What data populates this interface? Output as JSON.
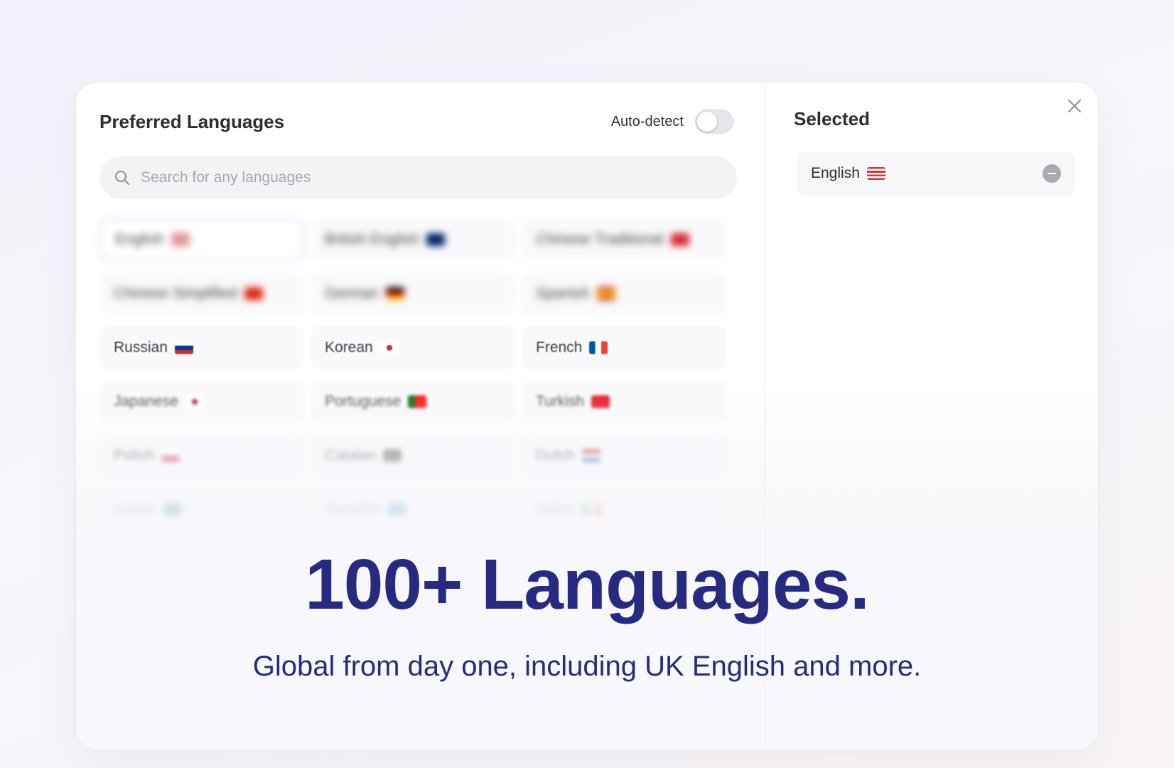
{
  "panel": {
    "title": "Preferred Languages",
    "auto_detect_label": "Auto-detect",
    "auto_detect_on": false
  },
  "search": {
    "placeholder": "Search for any languages",
    "value": ""
  },
  "languages": [
    {
      "label": "English",
      "flag": "flag-us-icon",
      "selected": true
    },
    {
      "label": "British English",
      "flag": "flag-gb-icon",
      "selected": false
    },
    {
      "label": "Chinese Traditional",
      "flag": "flag-tw-icon",
      "selected": false
    },
    {
      "label": "Chinese Simplified",
      "flag": "flag-cn-icon",
      "selected": false
    },
    {
      "label": "German",
      "flag": "flag-de-icon",
      "selected": false
    },
    {
      "label": "Spanish",
      "flag": "flag-es-icon",
      "selected": false
    },
    {
      "label": "Russian",
      "flag": "flag-ru-icon",
      "selected": false
    },
    {
      "label": "Korean",
      "flag": "flag-kr-icon",
      "selected": false
    },
    {
      "label": "French",
      "flag": "flag-fr-icon",
      "selected": false
    },
    {
      "label": "Japanese",
      "flag": "flag-jp-icon",
      "selected": false
    },
    {
      "label": "Portuguese",
      "flag": "flag-pt-icon",
      "selected": false
    },
    {
      "label": "Turkish",
      "flag": "flag-tr-icon",
      "selected": false
    },
    {
      "label": "Polish",
      "flag": "flag-pl-icon",
      "selected": false
    },
    {
      "label": "Catalan",
      "flag": "flag-ct-icon",
      "selected": false
    },
    {
      "label": "Dutch",
      "flag": "flag-nl-icon",
      "selected": false
    },
    {
      "label": "Arabic",
      "flag": "flag-sa-icon",
      "selected": false
    },
    {
      "label": "Swedish",
      "flag": "flag-se-icon",
      "selected": false
    },
    {
      "label": "Italian",
      "flag": "flag-it-icon",
      "selected": false
    }
  ],
  "selected_panel": {
    "title": "Selected",
    "items": [
      {
        "label": "English",
        "flag": "flag-us-icon"
      }
    ]
  },
  "hero": {
    "title": "100+ Languages.",
    "subtitle": "Global from day one, including UK English and more."
  },
  "colors": {
    "accent": "#262a80",
    "selected_border": "#cfd0f3"
  }
}
